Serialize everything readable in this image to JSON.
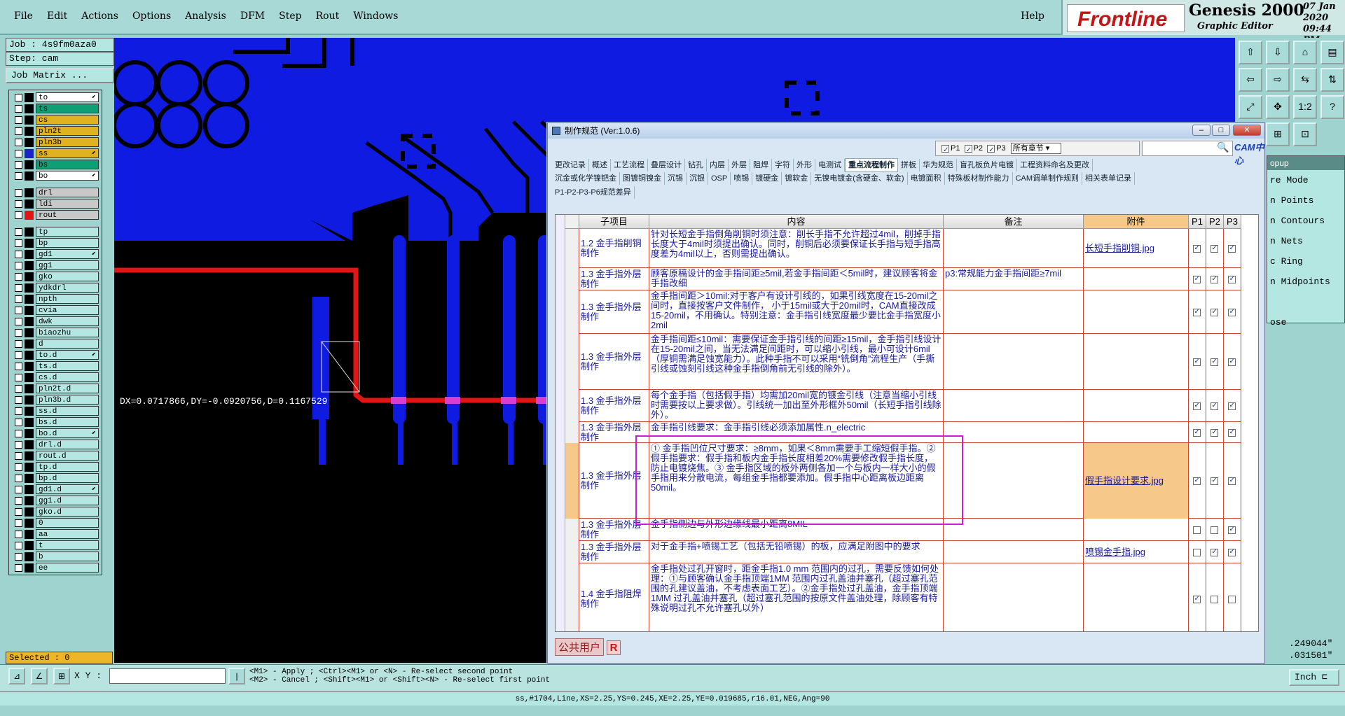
{
  "menu": [
    "File",
    "Edit",
    "Actions",
    "Options",
    "Analysis",
    "DFM",
    "Step",
    "Rout",
    "Windows"
  ],
  "help": "Help",
  "brand": {
    "logo": "Frontline",
    "product": "Genesis 2000",
    "subtitle": "Graphic Editor",
    "date": "07 Jan 2020",
    "time": "09:44 PM"
  },
  "job": "Job : 4s9fm0aza0",
  "step": "Step: cam",
  "job_matrix": "Job Matrix ...",
  "layers": [
    {
      "name": "to",
      "color": "#ffffff",
      "sq": "#000000",
      "flag": "⬋"
    },
    {
      "name": "ts",
      "color": "#0f9f74",
      "sq": "#000000",
      "flag": ""
    },
    {
      "name": "cs",
      "color": "#e0b21f",
      "sq": "#000000",
      "flag": ""
    },
    {
      "name": "pln2t",
      "color": "#e0b21f",
      "sq": "#000000",
      "flag": ""
    },
    {
      "name": "pln3b",
      "color": "#e0b21f",
      "sq": "#000000",
      "flag": ""
    },
    {
      "name": "ss",
      "color": "#e0b21f",
      "sq": "#1a22c9",
      "flag": "⬋"
    },
    {
      "name": "bs",
      "color": "#0f9f74",
      "sq": "#000000",
      "flag": ""
    },
    {
      "name": "bo",
      "color": "#ffffff",
      "sq": "#000000",
      "flag": "⬋"
    },
    {
      "gap": true
    },
    {
      "name": "drl",
      "color": "#c8c8c8",
      "sq": "#000000",
      "flag": ""
    },
    {
      "name": "ldi",
      "color": "#c8c8c8",
      "sq": "#000000",
      "flag": ""
    },
    {
      "name": "rout",
      "color": "#c8c8c8",
      "sq": "#e31414",
      "flag": ""
    },
    {
      "gap": true
    },
    {
      "name": "tp",
      "color": "#b4e6e2",
      "sq": "#000000",
      "flag": ""
    },
    {
      "name": "bp",
      "color": "#b4e6e2",
      "sq": "#000000",
      "flag": ""
    },
    {
      "name": "gd1",
      "color": "#b4e6e2",
      "sq": "#000000",
      "flag": "⬋"
    },
    {
      "name": "gg1",
      "color": "#b4e6e2",
      "sq": "#000000",
      "flag": ""
    },
    {
      "name": "gko",
      "color": "#b4e6e2",
      "sq": "#000000",
      "flag": ""
    },
    {
      "name": "ydkdrl",
      "color": "#b4e6e2",
      "sq": "#000000",
      "flag": ""
    },
    {
      "name": "npth",
      "color": "#b4e6e2",
      "sq": "#000000",
      "flag": ""
    },
    {
      "name": "cvia",
      "color": "#b4e6e2",
      "sq": "#000000",
      "flag": ""
    },
    {
      "name": "dwk",
      "color": "#b4e6e2",
      "sq": "#000000",
      "flag": ""
    },
    {
      "name": "biaozhu",
      "color": "#b4e6e2",
      "sq": "#000000",
      "flag": ""
    },
    {
      "name": "d",
      "color": "#b4e6e2",
      "sq": "#000000",
      "flag": ""
    },
    {
      "name": "to.d",
      "color": "#b4e6e2",
      "sq": "#000000",
      "flag": "⬋"
    },
    {
      "name": "ts.d",
      "color": "#b4e6e2",
      "sq": "#000000",
      "flag": ""
    },
    {
      "name": "cs.d",
      "color": "#b4e6e2",
      "sq": "#000000",
      "flag": ""
    },
    {
      "name": "pln2t.d",
      "color": "#b4e6e2",
      "sq": "#000000",
      "flag": ""
    },
    {
      "name": "pln3b.d",
      "color": "#b4e6e2",
      "sq": "#000000",
      "flag": ""
    },
    {
      "name": "ss.d",
      "color": "#b4e6e2",
      "sq": "#000000",
      "flag": ""
    },
    {
      "name": "bs.d",
      "color": "#b4e6e2",
      "sq": "#000000",
      "flag": ""
    },
    {
      "name": "bo.d",
      "color": "#b4e6e2",
      "sq": "#000000",
      "flag": "⬋"
    },
    {
      "name": "drl.d",
      "color": "#b4e6e2",
      "sq": "#000000",
      "flag": ""
    },
    {
      "name": "rout.d",
      "color": "#b4e6e2",
      "sq": "#000000",
      "flag": ""
    },
    {
      "name": "tp.d",
      "color": "#b4e6e2",
      "sq": "#000000",
      "flag": ""
    },
    {
      "name": "bp.d",
      "color": "#b4e6e2",
      "sq": "#000000",
      "flag": ""
    },
    {
      "name": "gd1.d",
      "color": "#b4e6e2",
      "sq": "#000000",
      "flag": "⬋"
    },
    {
      "name": "gg1.d",
      "color": "#b4e6e2",
      "sq": "#000000",
      "flag": ""
    },
    {
      "name": "gko.d",
      "color": "#b4e6e2",
      "sq": "#000000",
      "flag": ""
    },
    {
      "name": "0",
      "color": "#b4e6e2",
      "sq": "#000000",
      "flag": ""
    },
    {
      "name": "aa",
      "color": "#b4e6e2",
      "sq": "#000000",
      "flag": ""
    },
    {
      "name": "t",
      "color": "#b4e6e2",
      "sq": "#000000",
      "flag": ""
    },
    {
      "name": "b",
      "color": "#b4e6e2",
      "sq": "#000000",
      "flag": ""
    },
    {
      "name": "ee",
      "color": "#b4e6e2",
      "sq": "#000000",
      "flag": ""
    }
  ],
  "selected": "Selected : 0",
  "measure": "DX=0.0717866,DY=-0.0920756,D=0.1167529",
  "dialog": {
    "title": "制作规范 (Ver:1.0.6)",
    "filters": [
      "P1",
      "P2",
      "P3"
    ],
    "chapter": "所有章节",
    "cam_label": "CAM中心",
    "tabs_row1": [
      "更改记录",
      "概述",
      "工艺流程",
      "叠层设计",
      "钻孔",
      "内层",
      "外层",
      "阻焊",
      "字符",
      "外形",
      "电测试",
      "重点流程制作",
      "拼板",
      "华为规范",
      "盲孔板负片电镀",
      "工程资料命名及更改"
    ],
    "active_tab": "重点流程制作",
    "tabs_row2": [
      "沉金或化学镍钯金",
      "图镀铜镍金",
      "沉锡",
      "沉银",
      "OSP",
      "喷锡",
      "镀硬金",
      "镀软金",
      "无镍电镀金(含硬金、软金)",
      "电镀面积",
      "特殊板材制作能力",
      "CAM调单制作规则",
      "相关表单记录"
    ],
    "tabs_row3": [
      "P1-P2-P3-P6规范差异"
    ],
    "headers": [
      "子项目",
      "内容",
      "备注",
      "附件",
      "P1",
      "P2",
      "P3"
    ],
    "rows": [
      {
        "sub": "1.2 金手指削铜制作",
        "content": "针对长短金手指倒角削铜时须注意：削长手指不允许超过4mil，削掉手指长度大于4mil时须提出确认。同时，削铜后必须要保证长手指与短手指高度差为4mil以上，否则需提出确认。",
        "note": "",
        "att": "长短手指削铜.jpg",
        "p": [
          true,
          true,
          true
        ],
        "h": 56
      },
      {
        "sub": "1.3 金手指外层制作",
        "content": "顾客原稿设计的金手指间距≥5mil,若金手指间距＜5mil时，建议顾客将金手指改细",
        "note": "p3:常规能力金手指间距≥7mil",
        "att": "",
        "p": [
          true,
          true,
          true
        ],
        "h": 32
      },
      {
        "sub": "1.3 金手指外层制作",
        "content": "金手指间距＞10mil:对于客户有设计引线的，如果引线宽度在15-20mil之间时，直接按客户文件制作， 小于15mil或大于20mil时，CAM直接改成15-20mil，不用确认。特别注意：金手指引线宽度最少要比金手指宽度小2mil",
        "note": "",
        "att": "",
        "p": [
          true,
          true,
          true
        ],
        "h": 62
      },
      {
        "sub": "1.3 金手指外层制作",
        "content": "金手指间距≤10mil：需要保证金手指引线的间距≥15mil，金手指引线设计在15-20mil之间，当无法满足间距时，可以缩小引线，最小可设计6mil（厚铜需满足蚀宽能力）。此种手指不可以采用“铣倒角”流程生产（手撕引线或蚀刻引线这种金手指倒角前无引线的除外）。",
        "note": "",
        "att": "",
        "p": [
          true,
          true,
          true
        ],
        "h": 80
      },
      {
        "sub": "1.3 金手指外层制作",
        "content": "每个金手指（包括假手指）均需加20mil宽的镀金引线（注意当缩小引线时需要按以上要求做）。引线统一加出至外形框外50mil（长短手指引线除外）。",
        "note": "",
        "att": "",
        "p": [
          true,
          true,
          true
        ],
        "h": 46
      },
      {
        "sub": "1.3 金手指外层制作",
        "content": "金手指引线要求：金手指引线必须添加属性.n_electric",
        "note": "",
        "att": "",
        "p": [
          true,
          true,
          true
        ],
        "h": 30
      },
      {
        "sub": "1.3 金手指外层制作",
        "content": "① 金手指凹位尺寸要求：≥8mm，如果＜8mm需要手工缩短假手指。② 假手指要求：假手指和板内金手指长度相差20%需要修改假手指长度，防止电镀烧焦。③ 金手指区域的板外两侧各加一个与板内一样大小的假手指用来分散电流，每组金手指都要添加。假手指中心距离板边距离50mil。",
        "note": "",
        "att": "假手指设计要求.jpg",
        "p": [
          true,
          true,
          true
        ],
        "h": 108,
        "hl": true
      },
      {
        "sub": "1.3 金手指外层制作",
        "content": "金手指侧边与外形边缘线最小距离8MIL",
        "note": "",
        "att": "",
        "p": [
          false,
          false,
          true
        ],
        "h": 32
      },
      {
        "sub": "1.3 金手指外层制作",
        "content": "对于金手指+喷锡工艺（包括无铅喷锡）的板，应满足附图中的要求",
        "note": "",
        "att": "喷锡金手指.jpg",
        "p": [
          false,
          true,
          true
        ],
        "h": 32
      },
      {
        "sub": "1.4 金手指阻焊制作",
        "content": "金手指处过孔开窗时，距金手指1.0 mm 范围内的过孔，需要反馈如何处理：①与顾客确认金手指顶端1MM 范围内过孔盖油并塞孔（超过塞孔范围的孔建议盖油，不考虑表面工艺）。②金手指处过孔盖油，金手指顶端1MM 过孔盖油并塞孔（超过塞孔范围的按原文件盖油处理，除顾客有特殊说明过孔不允许塞孔以外）",
        "note": "",
        "att": "",
        "p": [
          true,
          false,
          false
        ],
        "h": 102
      }
    ],
    "footer_user": "公共用户",
    "footer_badge": "R"
  },
  "popup": {
    "title": "opup",
    "items": [
      "re Mode",
      "n Points",
      "n Contours",
      "n Nets",
      "c Ring",
      "n Midpoints",
      "",
      "ose"
    ]
  },
  "right_readouts": [
    ".249044\"",
    ".031501\""
  ],
  "bottom": {
    "xy_label": "X Y :",
    "hint1": "<M1> - Apply  ; <Ctrl><M1> or <N> - Re-select second point",
    "hint2": "<M2> - Cancel ; <Shift><M1> or <Shift><N> - Re-select first point",
    "unit": "Inch",
    "status": "ss,#1704,Line,XS=2.25,YS=0.245,XE=2.25,YE=0.019685,r16.01,NEG,Ang=90"
  }
}
